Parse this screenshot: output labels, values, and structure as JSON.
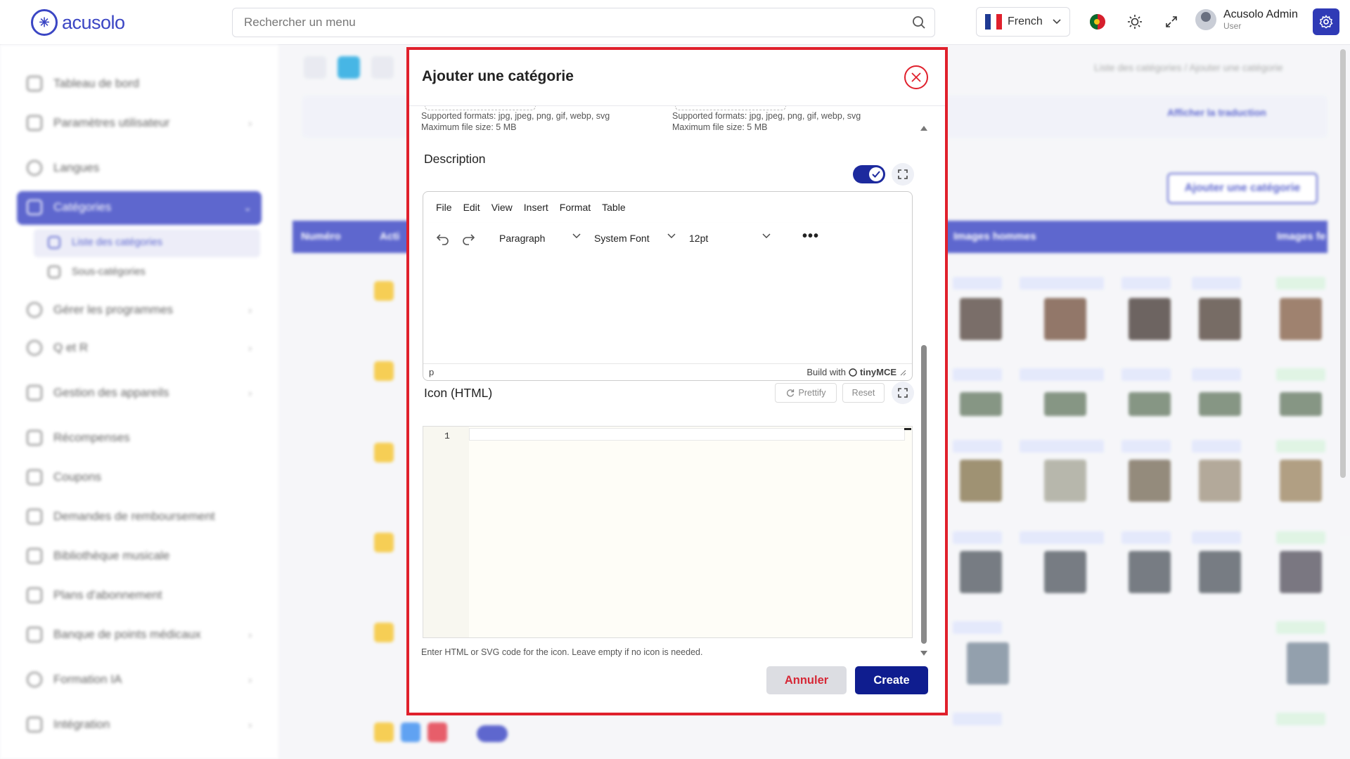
{
  "header": {
    "logo_text": "acusolo",
    "search_placeholder": "Rechercher un menu",
    "language": "French",
    "user_name": "Acusolo Admin",
    "user_role": "User",
    "accent_color": "#2f3ab6"
  },
  "sidebar": {
    "items": [
      {
        "label": "Tableau de bord"
      },
      {
        "label": "Paramètres utilisateur"
      },
      {
        "label": "Langues"
      },
      {
        "label": "Catégories"
      },
      {
        "label": "Liste des catégories"
      },
      {
        "label": "Sous-catégories"
      },
      {
        "label": "Gérer les programmes"
      },
      {
        "label": "Q et R"
      },
      {
        "label": "Gestion des appareils"
      },
      {
        "label": "Récompenses"
      },
      {
        "label": "Coupons"
      },
      {
        "label": "Demandes de remboursement"
      },
      {
        "label": "Bibliothèque musicale"
      },
      {
        "label": "Plans d'abonnement"
      },
      {
        "label": "Banque de points médicaux"
      },
      {
        "label": "Formation IA"
      },
      {
        "label": "Intégration"
      }
    ]
  },
  "background": {
    "breadcrumb": "Liste des catégories / Ajouter une catégorie",
    "add_button": "Ajouter une catégorie",
    "show_translation": "Afficher la traduction",
    "table_headers": [
      "Numéro",
      "Acti",
      "Images hommes",
      "Images fe"
    ]
  },
  "modal": {
    "title": "Ajouter une catégorie",
    "upload_left": {
      "formats": "Supported formats: jpg, jpeg, png, gif, webp, svg",
      "max_size": "Maximum file size: 5 MB"
    },
    "upload_right": {
      "formats": "Supported formats: jpg, jpeg, png, gif, webp, svg",
      "max_size": "Maximum file size: 5 MB"
    },
    "description": {
      "label": "Description",
      "toggle_on": true,
      "menu": [
        "File",
        "Edit",
        "View",
        "Insert",
        "Format",
        "Table"
      ],
      "block_format": "Paragraph",
      "font_family": "System Font",
      "font_size": "12pt",
      "status_path": "p",
      "branding": "Build with",
      "branding_name": "tinyMCE"
    },
    "icon_html": {
      "label": "Icon (HTML)",
      "prettify_label": "Prettify",
      "reset_label": "Reset",
      "line_number": "1",
      "help": "Enter HTML or SVG code for the icon. Leave empty if no icon is needed."
    },
    "buttons": {
      "cancel": "Annuler",
      "create": "Create"
    }
  },
  "colors": {
    "primary": "#0f1d8f",
    "danger": "#e0202c",
    "toggle": "#1d2a9e"
  }
}
